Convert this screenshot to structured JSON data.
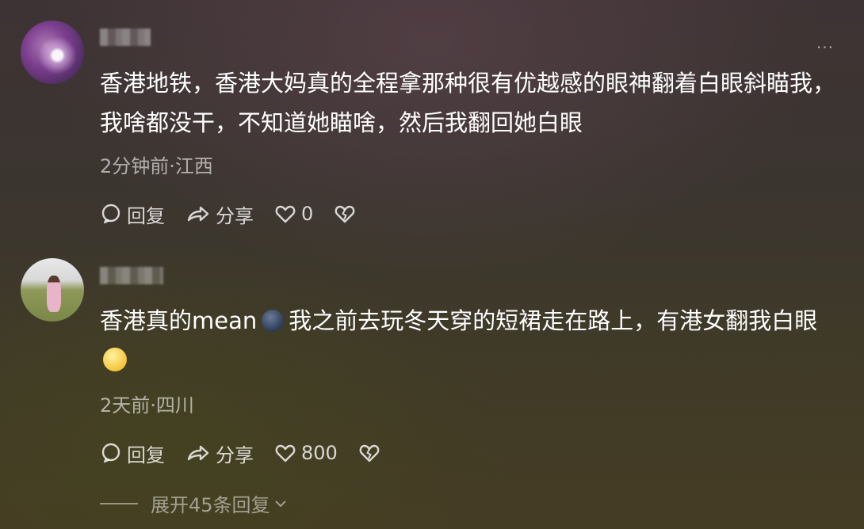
{
  "comments": [
    {
      "text": "香港地铁，香港大妈真的全程拿那种很有优越感的眼神翻着白眼斜瞄我，我啥都没干，不知道她瞄啥，然后我翻回她白眼",
      "meta": "2分钟前·江西",
      "reply_label": "回复",
      "share_label": "分享",
      "like_count": "0"
    },
    {
      "text_part1": "香港真的mean",
      "text_part2": "我之前去玩冬天穿的短裙走在路上，有港女翻我白眼",
      "meta": "2天前·四川",
      "reply_label": "回复",
      "share_label": "分享",
      "like_count": "800"
    }
  ],
  "more_icon": "more-dots-icon",
  "expand_label": "展开45条回复"
}
